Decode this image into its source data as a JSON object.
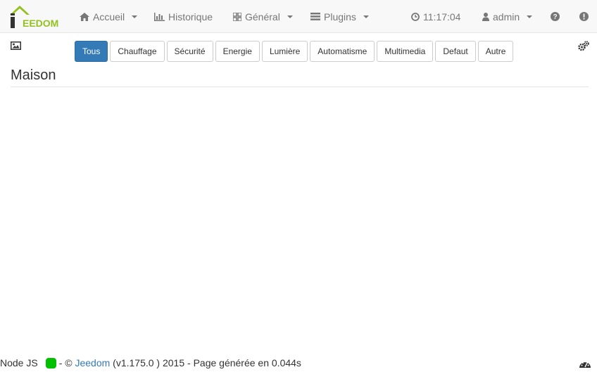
{
  "brand": {
    "logo_text": "EEDOM",
    "logo_initial": "J"
  },
  "nav": {
    "accueil": "Accueil",
    "historique": "Historique",
    "general": "Général",
    "plugins": "Plugins",
    "time": "11:17:04",
    "user": "admin"
  },
  "filters": [
    "Tous",
    "Chauffage",
    "Sécurité",
    "Energie",
    "Lumière",
    "Automatisme",
    "Multimedia",
    "Defaut",
    "Autre"
  ],
  "active_filter": "Tous",
  "page": {
    "title": "Maison"
  },
  "footer": {
    "node_label": "Node JS",
    "sep": "- ©",
    "link": "Jeedom",
    "version": "(v1.175.0 ) 2015 - Page générée en 0.044s"
  },
  "colors": {
    "accent": "#337ab7",
    "brand_green": "#94c11f",
    "status_ok": "#00c000"
  },
  "icons": [
    "home-icon",
    "bar-chart-icon",
    "grid-icon",
    "list-icon",
    "clock-icon",
    "user-icon",
    "question-icon",
    "exclamation-icon",
    "picture-icon",
    "cogs-icon",
    "dashboard-icon"
  ]
}
